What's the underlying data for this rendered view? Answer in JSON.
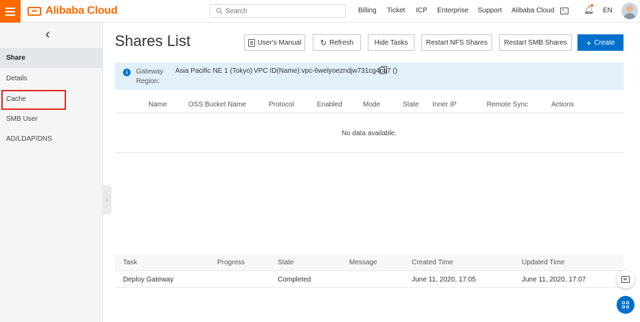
{
  "header": {
    "brand": "Alibaba Cloud",
    "search_placeholder": "Search",
    "nav": [
      "Billing",
      "Ticket",
      "ICP",
      "Enterprise",
      "Support",
      "Alibaba Cloud"
    ],
    "language": "EN"
  },
  "sidebar": {
    "items": [
      {
        "label": "Share",
        "active": true
      },
      {
        "label": "Details",
        "active": false
      },
      {
        "label": "Cache",
        "active": false,
        "highlighted": true
      },
      {
        "label": "SMB User",
        "active": false
      },
      {
        "label": "AD/LDAP/DNS",
        "active": false
      }
    ]
  },
  "main": {
    "title": "Shares List",
    "buttons": {
      "manual": "User's Manual",
      "refresh": "Refresh",
      "hide_tasks": "Hide Tasks",
      "restart_nfs": "Restart NFS Shares",
      "restart_smb": "Restart SMB Shares",
      "create": "Create"
    },
    "info": {
      "label": "Gateway Region:",
      "region": "Asia Pacific NE 1 (Tokyo)",
      "vpc": "VPC ID(Name):vpc-6welyoezndjw731cg4cq7 ()"
    },
    "shares_table": {
      "columns": [
        "Name",
        "OSS Bucket Name",
        "Protocol",
        "Enabled",
        "Mode",
        "State",
        "Inner IP",
        "Remote Sync",
        "Actions"
      ],
      "empty": "No data available."
    },
    "tasks_table": {
      "columns": [
        "Task",
        "Progress",
        "State",
        "Message",
        "Created Time",
        "Updated Time"
      ],
      "rows": [
        {
          "task": "Deploy Gateway",
          "progress": "",
          "state": "Completed",
          "message": "",
          "created": "June 11, 2020, 17:05",
          "updated": "June 11, 2020, 17:07"
        }
      ]
    }
  },
  "colors": {
    "brand": "#ff6a00",
    "primary": "#0070cc",
    "highlight_box": "#e1251b"
  }
}
